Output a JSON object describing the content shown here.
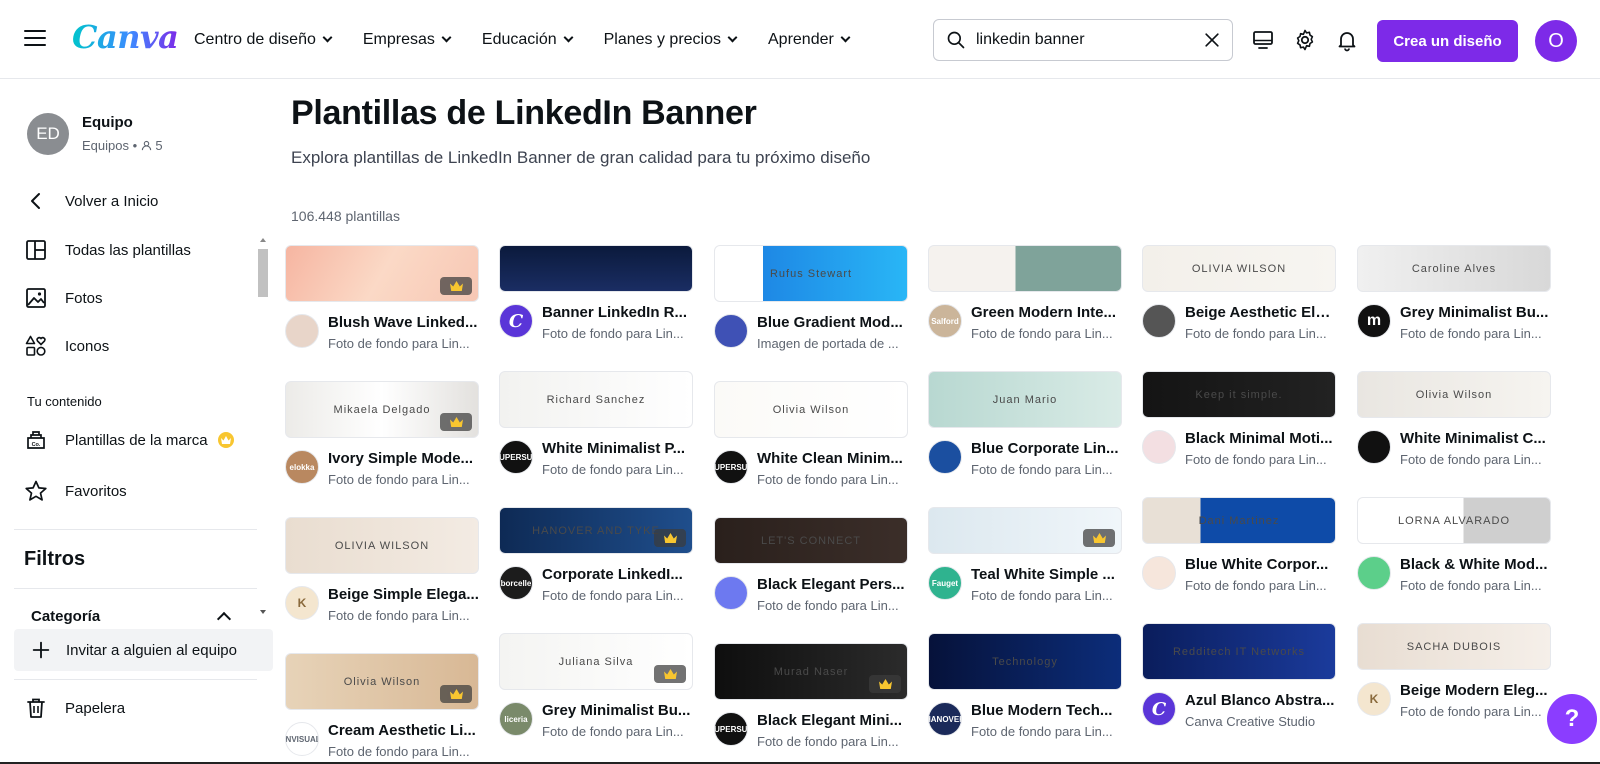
{
  "topbar": {
    "logo": "Canva",
    "nav": [
      "Centro de diseño",
      "Empresas",
      "Educación",
      "Planes y precios",
      "Aprender"
    ],
    "search_value": "linkedin banner",
    "create_label": "Crea un diseño",
    "user_initial": "O"
  },
  "sidebar": {
    "team_initials": "ED",
    "team_name": "Equipo",
    "team_sub": "Equipos • ",
    "team_members": "5",
    "back": "Volver a Inicio",
    "items": [
      "Todas las plantillas",
      "Fotos",
      "Iconos"
    ],
    "content_section": "Tu contenido",
    "brand": "Plantillas de la marca",
    "favorites": "Favoritos",
    "filters": "Filtros",
    "category": "Categoría",
    "invite": "Invitar a alguien al equipo",
    "trash": "Papelera"
  },
  "main": {
    "title": "Plantillas de LinkedIn Banner",
    "subtitle": "Explora plantillas de LinkedIn Banner de gran calidad para tu próximo diseño",
    "count": "106.448 plantillas"
  },
  "columns": [
    [
      {
        "title": "Blush Wave Linked...",
        "sub": "Foto de fondo para Lin...",
        "bg": "linear-gradient(120deg,#f6b5a1,#fbd9c6,#f7c7b4)",
        "txt": "",
        "crown": true,
        "av": "#e8d5c9",
        "avtxt": ""
      },
      {
        "title": "Ivory Simple Mode...",
        "sub": "Foto de fondo para Lin...",
        "bg": "linear-gradient(90deg,#ecebe8,#ffffff,#e3e1de)",
        "txt": "Mikaela Delgado",
        "crown": true,
        "av": "#b98860",
        "avtxt": "elokka"
      },
      {
        "title": "Beige Simple Elega...",
        "sub": "Foto de fondo para Lin...",
        "bg": "linear-gradient(90deg,#e9ddd0,#f3ebe3)",
        "txt": "OLIVIA WILSON",
        "crown": false,
        "av": "#f4e6cf",
        "avtxt": "K"
      },
      {
        "title": "Cream Aesthetic Li...",
        "sub": "Foto de fondo para Lin...",
        "bg": "linear-gradient(90deg,#e7d3b8,#d8b895)",
        "txt": "Olivia Wilson",
        "crown": true,
        "av": "#ffffff",
        "avtxt": "INVISUAL"
      }
    ],
    [
      {
        "title": "Banner LinkedIn R...",
        "sub": "Foto de fondo para Lin...",
        "bg": "linear-gradient(180deg,#0b1a3c,#1a2d63)",
        "txt": "",
        "crown": false,
        "av": "#5a35d8",
        "avtxt": "C"
      },
      {
        "title": "White Minimalist P...",
        "sub": "Foto de fondo para Lin...",
        "bg": "linear-gradient(90deg,#f2f2f0,#ffffff)",
        "txt": "Richard Sanchez",
        "crown": false,
        "av": "#111111",
        "avtxt": "SUPERSUB"
      },
      {
        "title": "Corporate LinkedI...",
        "sub": "Foto de fondo para Lin...",
        "bg": "linear-gradient(90deg,#0e2a55,#1f4e8c)",
        "txt": "HANOVER AND TYKE",
        "crown": true,
        "av": "#1c1c1c",
        "avtxt": "borcelle"
      },
      {
        "title": "Grey Minimalist Bu...",
        "sub": "Foto de fondo para Lin...",
        "bg": "linear-gradient(90deg,#f4f4f2,#ffffff)",
        "txt": "Juliana Silva",
        "crown": true,
        "av": "#7a8a6a",
        "avtxt": "liceria"
      }
    ],
    [
      {
        "title": "Blue Gradient Mod...",
        "sub": "Imagen de portada de ...",
        "bg": "linear-gradient(90deg,#ffffff 25%,#1e88e5 25%,#29b6f6)",
        "txt": "Rufus Stewart",
        "crown": false,
        "av": "#3f51b5",
        "avtxt": ""
      },
      {
        "title": "White Clean Minim...",
        "sub": "Foto de fondo para Lin...",
        "bg": "linear-gradient(90deg,#fbfaf7,#ffffff)",
        "txt": "Olivia Wilson",
        "crown": false,
        "av": "#111111",
        "avtxt": "SUPERSUB"
      },
      {
        "title": "Black Elegant Pers...",
        "sub": "Foto de fondo para Lin...",
        "bg": "linear-gradient(90deg,#2a201c,#3b2e29)",
        "txt": "LET'S CONNECT",
        "crown": false,
        "av": "#6d79f0",
        "avtxt": ""
      },
      {
        "title": "Black Elegant Mini...",
        "sub": "Foto de fondo para Lin...",
        "bg": "linear-gradient(90deg,#0e0e0e,#2b2b2b)",
        "txt": "Murad Naser",
        "crown": true,
        "av": "#111111",
        "avtxt": "SUPERSUB"
      }
    ],
    [
      {
        "title": "Green Modern Inte...",
        "sub": "Foto de fondo para Lin...",
        "bg": "linear-gradient(90deg,#f5f2ee 45%,#7fa39a 45%)",
        "txt": "",
        "crown": false,
        "av": "#cbb59a",
        "avtxt": "Salford"
      },
      {
        "title": "Blue Corporate Lin...",
        "sub": "Foto de fondo para Lin...",
        "bg": "linear-gradient(90deg,#b8d8d1,#d9ebe6)",
        "txt": "Juan Mario",
        "crown": false,
        "av": "#1b4fa0",
        "avtxt": ""
      },
      {
        "title": "Teal White Simple ...",
        "sub": "Foto de fondo para Lin...",
        "bg": "linear-gradient(90deg,#dce8ef,#f0f6fa)",
        "txt": "",
        "crown": true,
        "av": "#2fb38f",
        "avtxt": "Fauget"
      },
      {
        "title": "Blue Modern Tech...",
        "sub": "Foto de fondo para Lin...",
        "bg": "linear-gradient(90deg,#06123a,#0c2d7a)",
        "txt": "Technology",
        "crown": false,
        "av": "#1b2a5a",
        "avtxt": "HANOVER"
      }
    ],
    [
      {
        "title": "Beige Aesthetic Ele...",
        "sub": "Foto de fondo para Lin...",
        "bg": "linear-gradient(90deg,#f3f0ea,#f7f5f1)",
        "txt": "OLIVIA  WILSON",
        "crown": false,
        "av": "#555555",
        "avtxt": ""
      },
      {
        "title": "Black Minimal Moti...",
        "sub": "Foto de fondo para Lin...",
        "bg": "linear-gradient(90deg,#141414,#222222)",
        "txt": "Keep it simple.",
        "crown": false,
        "av": "#f3dfe2",
        "avtxt": ""
      },
      {
        "title": "Blue White Corpor...",
        "sub": "Foto de fondo para Lin...",
        "bg": "linear-gradient(90deg,#e8e0d6 30%,#0e4ba8 30%)",
        "txt": "Dani Martinez",
        "crown": false,
        "av": "#f6e6dc",
        "avtxt": ""
      },
      {
        "title": "Azul Blanco Abstra...",
        "sub": "Canva Creative Studio",
        "bg": "linear-gradient(90deg,#0a1d5c,#1b3b9c)",
        "txt": "Redditech IT Networks",
        "crown": false,
        "av": "#5a35d8",
        "avtxt": "C"
      }
    ],
    [
      {
        "title": "Grey Minimalist Bu...",
        "sub": "Foto de fondo para Lin...",
        "bg": "linear-gradient(90deg,#f0f0f0,#d8d8d8)",
        "txt": "Caroline Alves",
        "crown": false,
        "av": "#111111",
        "avtxt": "m"
      },
      {
        "title": "White Minimalist C...",
        "sub": "Foto de fondo para Lin...",
        "bg": "linear-gradient(90deg,#e9e6e1,#f6f4f0)",
        "txt": "Olivia Wilson",
        "crown": false,
        "av": "#111111",
        "avtxt": ""
      },
      {
        "title": "Black & White Mod...",
        "sub": "Foto de fondo para Lin...",
        "bg": "linear-gradient(90deg,#ffffff 55%,#cfcfcf 55%)",
        "txt": "LORNA ALVARADO",
        "crown": false,
        "av": "#5ccf8a",
        "avtxt": ""
      },
      {
        "title": "Beige Modern Eleg...",
        "sub": "Foto de fondo para Lin...",
        "bg": "linear-gradient(90deg,#e8ddd2,#f5efe9)",
        "txt": "SACHA DUBOIS",
        "crown": false,
        "av": "#f4e6cf",
        "avtxt": "K"
      }
    ]
  ],
  "help_label": "?"
}
